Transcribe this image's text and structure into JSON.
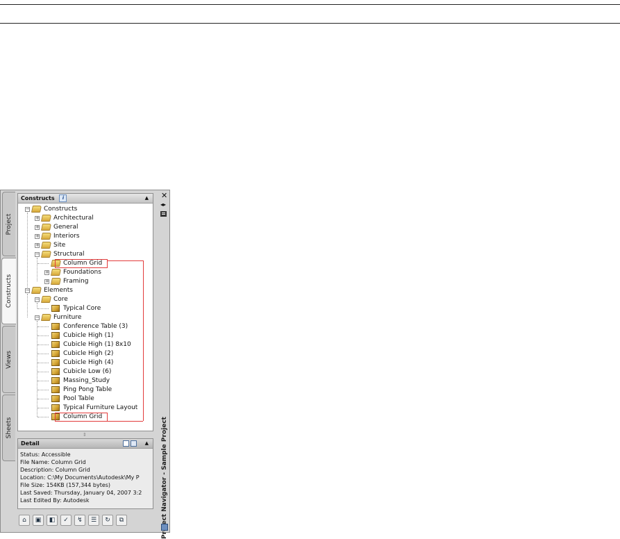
{
  "palette": {
    "title": "Project Navigator - Sample Project",
    "tabs": [
      "Project",
      "Constructs",
      "Views",
      "Sheets"
    ],
    "active_tab": "Constructs"
  },
  "constructs_panel": {
    "header": "Constructs",
    "tree": [
      {
        "label": "Constructs",
        "level": 0,
        "icon": "folder-icon",
        "expander": "minus"
      },
      {
        "label": "Architectural",
        "level": 1,
        "icon": "folder-icon",
        "expander": "plus"
      },
      {
        "label": "General",
        "level": 1,
        "icon": "folder-icon",
        "expander": "plus"
      },
      {
        "label": "Interiors",
        "level": 1,
        "icon": "folder-icon",
        "expander": "plus"
      },
      {
        "label": "Site",
        "level": 1,
        "icon": "folder-icon",
        "expander": "plus"
      },
      {
        "label": "Structural",
        "level": 1,
        "icon": "folder-icon",
        "expander": "minus"
      },
      {
        "label": "Column Grid",
        "level": 2,
        "icon": "folder-icon",
        "expander": "none",
        "highlighted": true
      },
      {
        "label": "Foundations",
        "level": 2,
        "icon": "folder-icon",
        "expander": "plus"
      },
      {
        "label": "Framing",
        "level": 2,
        "icon": "folder-icon",
        "expander": "plus"
      },
      {
        "label": "Elements",
        "level": 0,
        "icon": "folder-icon",
        "expander": "minus"
      },
      {
        "label": "Core",
        "level": 1,
        "icon": "folder-icon",
        "expander": "minus"
      },
      {
        "label": "Typical Core",
        "level": 2,
        "icon": "element-box-icon",
        "expander": "none"
      },
      {
        "label": "Furniture",
        "level": 1,
        "icon": "folder-icon",
        "expander": "minus"
      },
      {
        "label": "Conference Table (3)",
        "level": 2,
        "icon": "element-box-icon",
        "expander": "none"
      },
      {
        "label": "Cubicle High (1)",
        "level": 2,
        "icon": "element-box-icon",
        "expander": "none"
      },
      {
        "label": "Cubicle High (1) 8x10",
        "level": 2,
        "icon": "element-box-icon",
        "expander": "none"
      },
      {
        "label": "Cubicle High (2)",
        "level": 2,
        "icon": "element-box-icon",
        "expander": "none"
      },
      {
        "label": "Cubicle High (4)",
        "level": 2,
        "icon": "element-box-icon",
        "expander": "none"
      },
      {
        "label": "Cubicle Low (6)",
        "level": 2,
        "icon": "element-box-icon",
        "expander": "none"
      },
      {
        "label": "Massing_Study",
        "level": 2,
        "icon": "element-box-icon",
        "expander": "none"
      },
      {
        "label": "Ping Pong Table",
        "level": 2,
        "icon": "element-box-icon",
        "expander": "none"
      },
      {
        "label": "Pool Table",
        "level": 2,
        "icon": "element-box-icon",
        "expander": "none"
      },
      {
        "label": "Typical Furniture Layout",
        "level": 2,
        "icon": "element-box-icon",
        "expander": "none"
      },
      {
        "label": "Column Grid",
        "level": 2,
        "icon": "element-box-icon",
        "expander": "none",
        "highlighted": true
      }
    ]
  },
  "detail_panel": {
    "header": "Detail",
    "lines": [
      "Status: Accessible",
      "File Name: Column Grid",
      "Description: Column Grid",
      "Location: C:\\My Documents\\Autodesk\\My P",
      "File Size: 154KB (157,344 bytes)",
      "Last Saved: Thursday, January 04, 2007  3:2",
      "Last Edited By: Autodesk"
    ]
  },
  "toolbar": {
    "buttons": [
      "add-construct-icon",
      "add-element-icon",
      "new-category-icon",
      "repath-icon",
      "regenerate-icon",
      "list-view-icon",
      "refresh-icon",
      "copy-icon"
    ]
  },
  "colors": {
    "highlight": "#e23b3b",
    "folder": "#e8c25a"
  }
}
